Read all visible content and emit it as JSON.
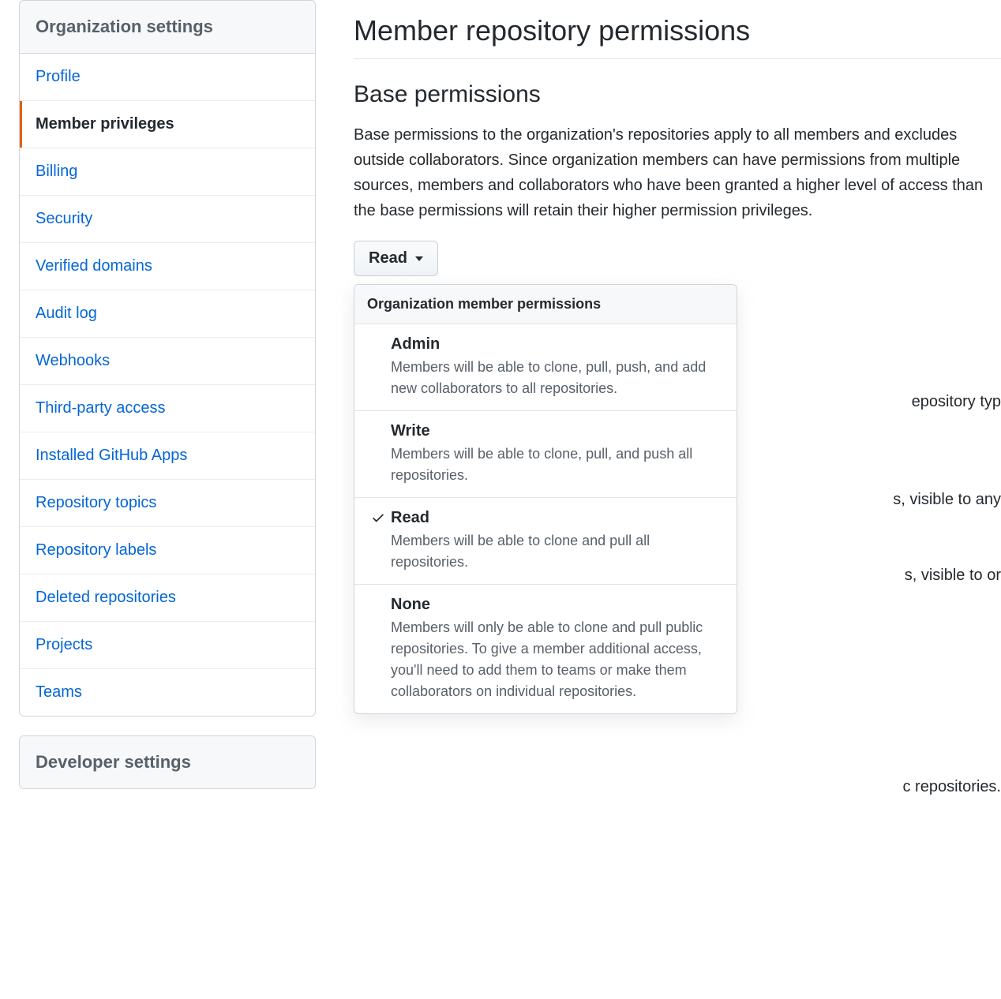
{
  "sidebar": {
    "header": "Organization settings",
    "items": [
      {
        "label": "Profile",
        "active": false
      },
      {
        "label": "Member privileges",
        "active": true
      },
      {
        "label": "Billing",
        "active": false
      },
      {
        "label": "Security",
        "active": false
      },
      {
        "label": "Verified domains",
        "active": false
      },
      {
        "label": "Audit log",
        "active": false
      },
      {
        "label": "Webhooks",
        "active": false
      },
      {
        "label": "Third-party access",
        "active": false
      },
      {
        "label": "Installed GitHub Apps",
        "active": false
      },
      {
        "label": "Repository topics",
        "active": false
      },
      {
        "label": "Repository labels",
        "active": false
      },
      {
        "label": "Deleted repositories",
        "active": false
      },
      {
        "label": "Projects",
        "active": false
      },
      {
        "label": "Teams",
        "active": false
      }
    ],
    "second_header": "Developer settings"
  },
  "main": {
    "title": "Member repository permissions",
    "section_title": "Base permissions",
    "section_desc": "Base permissions to the organization's repositories apply to all members and excludes outside collaborators. Since organization members can have permissions from multiple sources, members and collaborators who have been granted a higher level of access than the base permissions will retain their higher permission privileges.",
    "dropdown": {
      "selected": "Read",
      "header": "Organization member permissions",
      "options": [
        {
          "title": "Admin",
          "desc": "Members will be able to clone, pull, push, and add new collaborators to all repositories.",
          "selected": false
        },
        {
          "title": "Write",
          "desc": "Members will be able to clone, pull, and push all repositories.",
          "selected": false
        },
        {
          "title": "Read",
          "desc": "Members will be able to clone and pull all repositories.",
          "selected": true
        },
        {
          "title": "None",
          "desc": "Members will only be able to clone and pull public repositories. To give a member additional access, you'll need to add them to teams or make them collaborators on individual repositories.",
          "selected": false
        }
      ]
    },
    "bg_fragments": {
      "f1": "epository typ",
      "f2": "s, visible to any",
      "f3": "s, visible to or",
      "f4": "c repositories."
    }
  }
}
